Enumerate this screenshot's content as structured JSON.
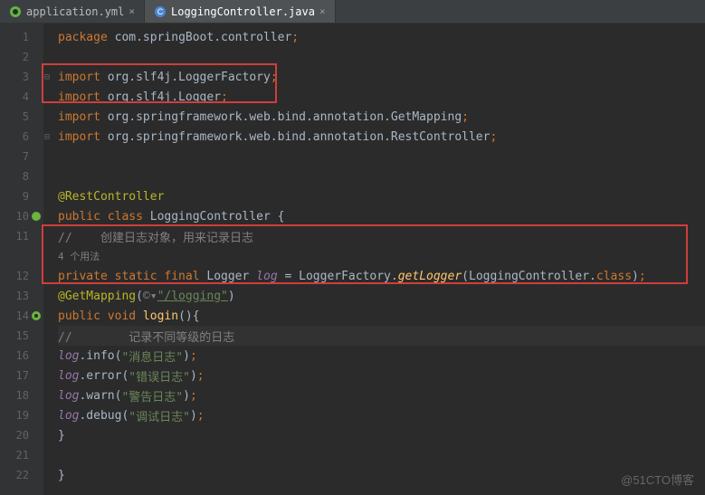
{
  "tabs": [
    {
      "icon_color": "#62b543",
      "label": "application.yml",
      "active": false
    },
    {
      "icon_color": "#4a86cf",
      "label": "LoggingController.java",
      "active": true
    }
  ],
  "line_numbers": [
    "1",
    "2",
    "3",
    "4",
    "5",
    "6",
    "7",
    "8",
    "9",
    "10",
    "11",
    "",
    "12",
    "13",
    "14",
    "15",
    "16",
    "17",
    "18",
    "19",
    "20",
    "21",
    "22"
  ],
  "code": {
    "l1_kw": "package",
    "l1_pkg": " com.springBoot.controller",
    "l3_kw": "import",
    "l3_pkg": " org.slf4j.LoggerFactory",
    "l4_kw": "import",
    "l4_pkg": " org.slf4j.Logger",
    "l5_kw": "import",
    "l5_pkg": " org.springframework.web.bind.annotation.",
    "l5_cls": "GetMapping",
    "l6_kw": "import",
    "l6_pkg": " org.springframework.web.bind.annotation.",
    "l6_cls": "RestController",
    "l9_anno": "@RestController",
    "l10_kw": "public class",
    "l10_name": " LoggingController ",
    "l11_comment": "//    创建日志对象，用来记录日志",
    "l11b_usage": "4 个用法",
    "l12_kw": "private static final",
    "l12_type": " Logger ",
    "l12_var": "log",
    "l12_eq": " = LoggerFactory.",
    "l12_call": "getLogger",
    "l12_arg": "(LoggingController.",
    "l12_class": "class",
    "l12_end": ")",
    "l13_anno": "@GetMapping",
    "l13_p1": "(",
    "l13_icon": "©▾",
    "l13_str": "\"/logging\"",
    "l13_p2": ")",
    "l14_kw": "public void",
    "l14_name": " login",
    "l14_paren": "(){",
    "l15_comment": "//        记录不同等级的日志",
    "l16_var": "log",
    "l16_call": ".info(",
    "l16_str": "\"消息日志\"",
    "l16_end": ")",
    "l17_var": "log",
    "l17_call": ".error(",
    "l17_str": "\"错误日志\"",
    "l17_end": ")",
    "l18_var": "log",
    "l18_call": ".warn(",
    "l18_str": "\"警告日志\"",
    "l18_end": ")",
    "l19_var": "log",
    "l19_call": ".debug(",
    "l19_str": "\"调试日志\"",
    "l19_end": ")",
    "semi": ";",
    "brace_open": "{",
    "brace_close": "}"
  },
  "watermark": "@51CTO博客"
}
